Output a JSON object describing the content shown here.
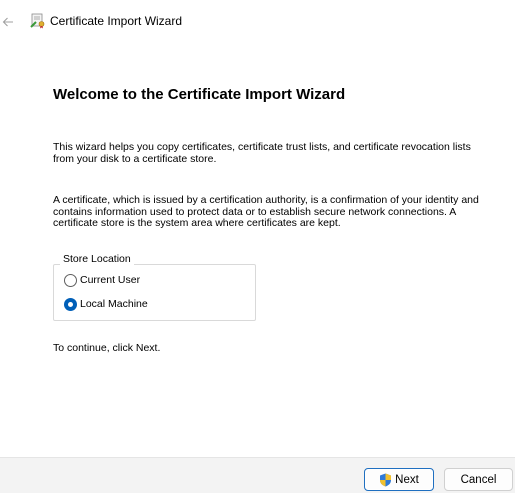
{
  "window": {
    "title": "Certificate Import Wizard",
    "icons": {
      "back": "back-arrow-icon",
      "app": "certificate-icon"
    }
  },
  "content": {
    "heading": "Welcome to the Certificate Import Wizard",
    "paragraph1": "This wizard helps you copy certificates, certificate trust lists, and certificate revocation lists from your disk to a certificate store.",
    "paragraph2": "A certificate, which is issued by a certification authority, is a confirmation of your identity and contains information used to protect data or to establish secure network connections. A certificate store is the system area where certificates are kept.",
    "store_location": {
      "legend": "Store Location",
      "options": [
        {
          "label": "Current User",
          "selected": false
        },
        {
          "label": "Local Machine",
          "selected": true
        }
      ]
    },
    "continue_text": "To continue, click Next."
  },
  "footer": {
    "next_label": "Next",
    "cancel_label": "Cancel",
    "icons": {
      "next": "uac-shield-icon"
    }
  },
  "colors": {
    "accent": "#005fb8",
    "footer_bg": "#f3f3f3"
  }
}
